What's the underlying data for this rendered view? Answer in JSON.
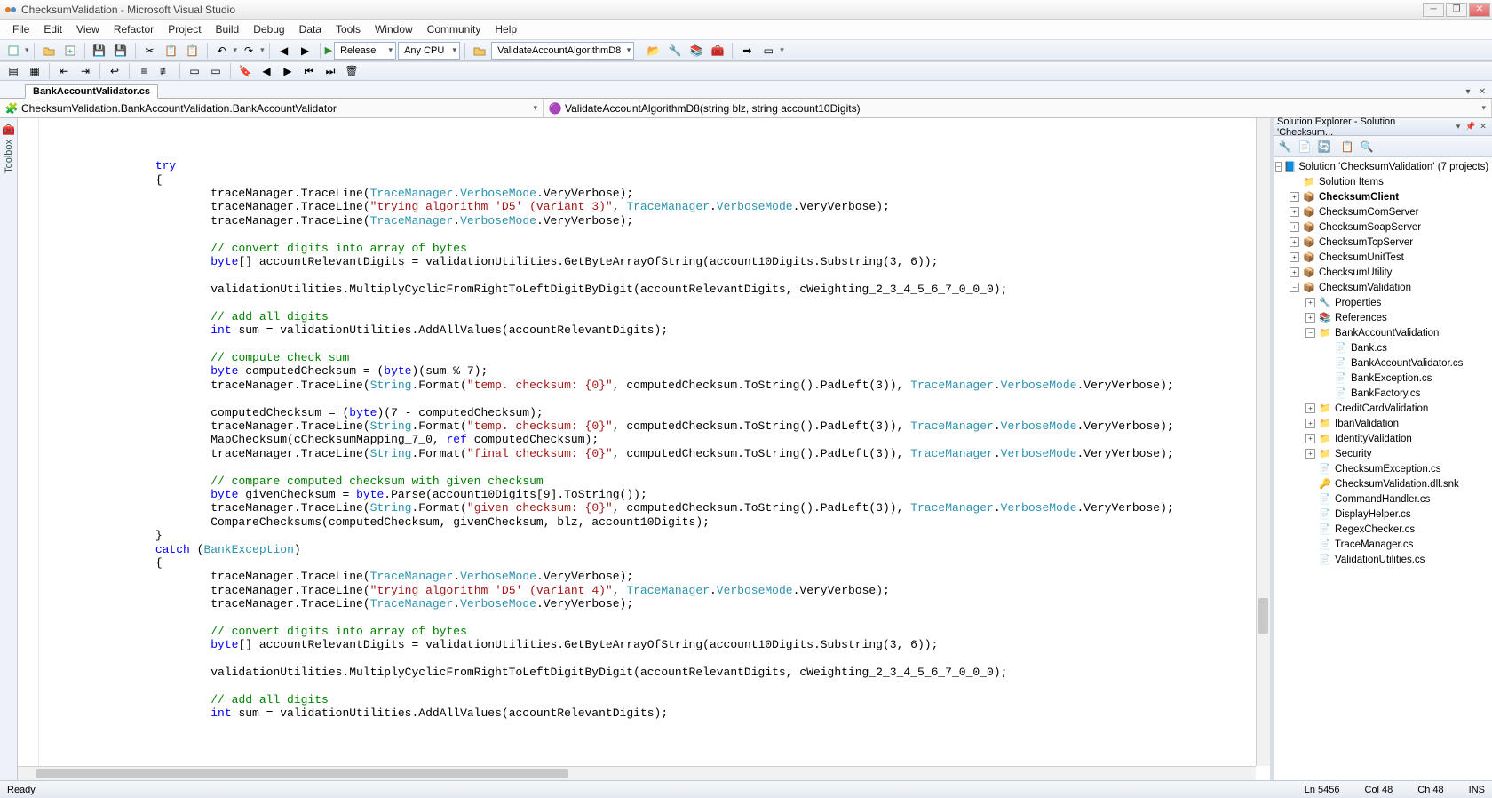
{
  "window": {
    "title": "ChecksumValidation - Microsoft Visual Studio"
  },
  "menu": [
    "File",
    "Edit",
    "View",
    "Refactor",
    "Project",
    "Build",
    "Debug",
    "Data",
    "Tools",
    "Window",
    "Community",
    "Help"
  ],
  "toolbar1": {
    "config": "Release",
    "platform": "Any CPU",
    "startup": "ValidateAccountAlgorithmD8"
  },
  "tabs": [
    {
      "label": "BankAccountValidator.cs"
    }
  ],
  "breadcrumb": {
    "class": "ChecksumValidation.BankAccountValidation.BankAccountValidator",
    "member": "ValidateAccountAlgorithmD8(string blz, string account10Digits)"
  },
  "code_lines": [
    {
      "i": 4,
      "seg": [
        [
          "k-key",
          "try"
        ]
      ]
    },
    {
      "i": 4,
      "seg": [
        [
          "",
          "{"
        ]
      ]
    },
    {
      "i": 6,
      "seg": [
        [
          "",
          "traceManager.TraceLine("
        ],
        [
          "k-type",
          "TraceManager"
        ],
        [
          "",
          "."
        ],
        [
          "k-type",
          "VerboseMode"
        ],
        [
          "",
          ".VeryVerbose);"
        ]
      ]
    },
    {
      "i": 6,
      "seg": [
        [
          "",
          "traceManager.TraceLine("
        ],
        [
          "k-str",
          "\"trying algorithm 'D5' (variant 3)\""
        ],
        [
          "",
          ", "
        ],
        [
          "k-type",
          "TraceManager"
        ],
        [
          "",
          "."
        ],
        [
          "k-type",
          "VerboseMode"
        ],
        [
          "",
          ".VeryVerbose);"
        ]
      ]
    },
    {
      "i": 6,
      "seg": [
        [
          "",
          "traceManager.TraceLine("
        ],
        [
          "k-type",
          "TraceManager"
        ],
        [
          "",
          "."
        ],
        [
          "k-type",
          "VerboseMode"
        ],
        [
          "",
          ".VeryVerbose);"
        ]
      ]
    },
    {
      "i": 0,
      "seg": [
        [
          "",
          ""
        ]
      ]
    },
    {
      "i": 6,
      "seg": [
        [
          "k-com",
          "// convert digits into array of bytes"
        ]
      ]
    },
    {
      "i": 6,
      "seg": [
        [
          "k-key",
          "byte"
        ],
        [
          "",
          "[] accountRelevantDigits = validationUtilities.GetByteArrayOfString(account10Digits.Substring(3, 6));"
        ]
      ]
    },
    {
      "i": 0,
      "seg": [
        [
          "",
          ""
        ]
      ]
    },
    {
      "i": 6,
      "seg": [
        [
          "",
          "validationUtilities.MultiplyCyclicFromRightToLeftDigitByDigit(accountRelevantDigits, cWeighting_2_3_4_5_6_7_0_0_0);"
        ]
      ]
    },
    {
      "i": 0,
      "seg": [
        [
          "",
          ""
        ]
      ]
    },
    {
      "i": 6,
      "seg": [
        [
          "k-com",
          "// add all digits"
        ]
      ]
    },
    {
      "i": 6,
      "seg": [
        [
          "k-key",
          "int"
        ],
        [
          "",
          " sum = validationUtilities.AddAllValues(accountRelevantDigits);"
        ]
      ]
    },
    {
      "i": 0,
      "seg": [
        [
          "",
          ""
        ]
      ]
    },
    {
      "i": 6,
      "seg": [
        [
          "k-com",
          "// compute check sum"
        ]
      ]
    },
    {
      "i": 6,
      "seg": [
        [
          "k-key",
          "byte"
        ],
        [
          "",
          " computedChecksum = ("
        ],
        [
          "k-key",
          "byte"
        ],
        [
          "",
          ")(sum % 7);"
        ]
      ]
    },
    {
      "i": 6,
      "seg": [
        [
          "",
          "traceManager.TraceLine("
        ],
        [
          "k-type",
          "String"
        ],
        [
          "",
          ".Format("
        ],
        [
          "k-str",
          "\"temp. checksum: {0}\""
        ],
        [
          "",
          ", computedChecksum.ToString().PadLeft(3)), "
        ],
        [
          "k-type",
          "TraceManager"
        ],
        [
          "",
          "."
        ],
        [
          "k-type",
          "VerboseMode"
        ],
        [
          "",
          ".VeryVerbose);"
        ]
      ]
    },
    {
      "i": 0,
      "seg": [
        [
          "",
          ""
        ]
      ]
    },
    {
      "i": 6,
      "seg": [
        [
          "",
          "computedChecksum = ("
        ],
        [
          "k-key",
          "byte"
        ],
        [
          "",
          ")(7 - computedChecksum);"
        ]
      ]
    },
    {
      "i": 6,
      "seg": [
        [
          "",
          "traceManager.TraceLine("
        ],
        [
          "k-type",
          "String"
        ],
        [
          "",
          ".Format("
        ],
        [
          "k-str",
          "\"temp. checksum: {0}\""
        ],
        [
          "",
          ", computedChecksum.ToString().PadLeft(3)), "
        ],
        [
          "k-type",
          "TraceManager"
        ],
        [
          "",
          "."
        ],
        [
          "k-type",
          "VerboseMode"
        ],
        [
          "",
          ".VeryVerbose);"
        ]
      ]
    },
    {
      "i": 6,
      "seg": [
        [
          "",
          "MapChecksum(cChecksumMapping_7_0, "
        ],
        [
          "k-key",
          "ref"
        ],
        [
          "",
          " computedChecksum);"
        ]
      ]
    },
    {
      "i": 6,
      "seg": [
        [
          "",
          "traceManager.TraceLine("
        ],
        [
          "k-type",
          "String"
        ],
        [
          "",
          ".Format("
        ],
        [
          "k-str",
          "\"final checksum: {0}\""
        ],
        [
          "",
          ", computedChecksum.ToString().PadLeft(3)), "
        ],
        [
          "k-type",
          "TraceManager"
        ],
        [
          "",
          "."
        ],
        [
          "k-type",
          "VerboseMode"
        ],
        [
          "",
          ".VeryVerbose);"
        ]
      ]
    },
    {
      "i": 0,
      "seg": [
        [
          "",
          ""
        ]
      ]
    },
    {
      "i": 6,
      "seg": [
        [
          "k-com",
          "// compare computed checksum with given checksum"
        ]
      ]
    },
    {
      "i": 6,
      "seg": [
        [
          "k-key",
          "byte"
        ],
        [
          "",
          " givenChecksum = "
        ],
        [
          "k-key",
          "byte"
        ],
        [
          "",
          ".Parse(account10Digits[9].ToString());"
        ]
      ]
    },
    {
      "i": 6,
      "seg": [
        [
          "",
          "traceManager.TraceLine("
        ],
        [
          "k-type",
          "String"
        ],
        [
          "",
          ".Format("
        ],
        [
          "k-str",
          "\"given checksum: {0}\""
        ],
        [
          "",
          ", computedChecksum.ToString().PadLeft(3)), "
        ],
        [
          "k-type",
          "TraceManager"
        ],
        [
          "",
          "."
        ],
        [
          "k-type",
          "VerboseMode"
        ],
        [
          "",
          ".VeryVerbose);"
        ]
      ]
    },
    {
      "i": 6,
      "seg": [
        [
          "",
          "CompareChecksums(computedChecksum, givenChecksum, blz, account10Digits);"
        ]
      ]
    },
    {
      "i": 4,
      "seg": [
        [
          "",
          "}"
        ]
      ]
    },
    {
      "i": 4,
      "seg": [
        [
          "k-key",
          "catch"
        ],
        [
          "",
          " ("
        ],
        [
          "k-type",
          "BankException"
        ],
        [
          "",
          ")"
        ]
      ]
    },
    {
      "i": 4,
      "seg": [
        [
          "",
          "{"
        ]
      ]
    },
    {
      "i": 6,
      "seg": [
        [
          "",
          "traceManager.TraceLine("
        ],
        [
          "k-type",
          "TraceManager"
        ],
        [
          "",
          "."
        ],
        [
          "k-type",
          "VerboseMode"
        ],
        [
          "",
          ".VeryVerbose);"
        ]
      ]
    },
    {
      "i": 6,
      "seg": [
        [
          "",
          "traceManager.TraceLine("
        ],
        [
          "k-str",
          "\"trying algorithm 'D5' (variant 4)\""
        ],
        [
          "",
          ", "
        ],
        [
          "k-type",
          "TraceManager"
        ],
        [
          "",
          "."
        ],
        [
          "k-type",
          "VerboseMode"
        ],
        [
          "",
          ".VeryVerbose);"
        ]
      ]
    },
    {
      "i": 6,
      "seg": [
        [
          "",
          "traceManager.TraceLine("
        ],
        [
          "k-type",
          "TraceManager"
        ],
        [
          "",
          "."
        ],
        [
          "k-type",
          "VerboseMode"
        ],
        [
          "",
          ".VeryVerbose);"
        ]
      ]
    },
    {
      "i": 0,
      "seg": [
        [
          "",
          ""
        ]
      ]
    },
    {
      "i": 6,
      "seg": [
        [
          "k-com",
          "// convert digits into array of bytes"
        ]
      ]
    },
    {
      "i": 6,
      "seg": [
        [
          "k-key",
          "byte"
        ],
        [
          "",
          "[] accountRelevantDigits = validationUtilities.GetByteArrayOfString(account10Digits.Substring(3, 6));"
        ]
      ]
    },
    {
      "i": 0,
      "seg": [
        [
          "",
          ""
        ]
      ]
    },
    {
      "i": 6,
      "seg": [
        [
          "",
          "validationUtilities.MultiplyCyclicFromRightToLeftDigitByDigit(accountRelevantDigits, cWeighting_2_3_4_5_6_7_0_0_0);"
        ]
      ]
    },
    {
      "i": 0,
      "seg": [
        [
          "",
          ""
        ]
      ]
    },
    {
      "i": 6,
      "seg": [
        [
          "k-com",
          "// add all digits"
        ]
      ]
    },
    {
      "i": 6,
      "seg": [
        [
          "k-key",
          "int"
        ],
        [
          "",
          " sum = validationUtilities.AddAllValues(accountRelevantDigits);"
        ]
      ]
    }
  ],
  "solution_explorer": {
    "title": "Solution Explorer - Solution 'Checksum...",
    "root": "Solution 'ChecksumValidation' (7 projects)",
    "nodes": [
      {
        "ind": 1,
        "exp": "none",
        "icon": "📁",
        "label": "Solution Items"
      },
      {
        "ind": 1,
        "exp": "+",
        "icon": "📦",
        "label": "ChecksumClient",
        "bold": true
      },
      {
        "ind": 1,
        "exp": "+",
        "icon": "📦",
        "label": "ChecksumComServer"
      },
      {
        "ind": 1,
        "exp": "+",
        "icon": "📦",
        "label": "ChecksumSoapServer"
      },
      {
        "ind": 1,
        "exp": "+",
        "icon": "📦",
        "label": "ChecksumTcpServer"
      },
      {
        "ind": 1,
        "exp": "+",
        "icon": "📦",
        "label": "ChecksumUnitTest"
      },
      {
        "ind": 1,
        "exp": "+",
        "icon": "📦",
        "label": "ChecksumUtility"
      },
      {
        "ind": 1,
        "exp": "-",
        "icon": "📦",
        "label": "ChecksumValidation"
      },
      {
        "ind": 2,
        "exp": "+",
        "icon": "🔧",
        "label": "Properties"
      },
      {
        "ind": 2,
        "exp": "+",
        "icon": "📚",
        "label": "References"
      },
      {
        "ind": 2,
        "exp": "-",
        "icon": "📁",
        "label": "BankAccountValidation"
      },
      {
        "ind": 3,
        "exp": "none",
        "icon": "📄",
        "label": "Bank.cs"
      },
      {
        "ind": 3,
        "exp": "none",
        "icon": "📄",
        "label": "BankAccountValidator.cs"
      },
      {
        "ind": 3,
        "exp": "none",
        "icon": "📄",
        "label": "BankException.cs"
      },
      {
        "ind": 3,
        "exp": "none",
        "icon": "📄",
        "label": "BankFactory.cs"
      },
      {
        "ind": 2,
        "exp": "+",
        "icon": "📁",
        "label": "CreditCardValidation"
      },
      {
        "ind": 2,
        "exp": "+",
        "icon": "📁",
        "label": "IbanValidation"
      },
      {
        "ind": 2,
        "exp": "+",
        "icon": "📁",
        "label": "IdentityValidation"
      },
      {
        "ind": 2,
        "exp": "+",
        "icon": "📁",
        "label": "Security"
      },
      {
        "ind": 2,
        "exp": "none",
        "icon": "📄",
        "label": "ChecksumException.cs"
      },
      {
        "ind": 2,
        "exp": "none",
        "icon": "🔑",
        "label": "ChecksumValidation.dll.snk"
      },
      {
        "ind": 2,
        "exp": "none",
        "icon": "📄",
        "label": "CommandHandler.cs"
      },
      {
        "ind": 2,
        "exp": "none",
        "icon": "📄",
        "label": "DisplayHelper.cs"
      },
      {
        "ind": 2,
        "exp": "none",
        "icon": "📄",
        "label": "RegexChecker.cs"
      },
      {
        "ind": 2,
        "exp": "none",
        "icon": "📄",
        "label": "TraceManager.cs"
      },
      {
        "ind": 2,
        "exp": "none",
        "icon": "📄",
        "label": "ValidationUtilities.cs"
      }
    ]
  },
  "statusbar": {
    "ready": "Ready",
    "ln": "Ln 5456",
    "col": "Col 48",
    "ch": "Ch 48",
    "ins": "INS"
  },
  "toolbox": {
    "label": "Toolbox"
  }
}
